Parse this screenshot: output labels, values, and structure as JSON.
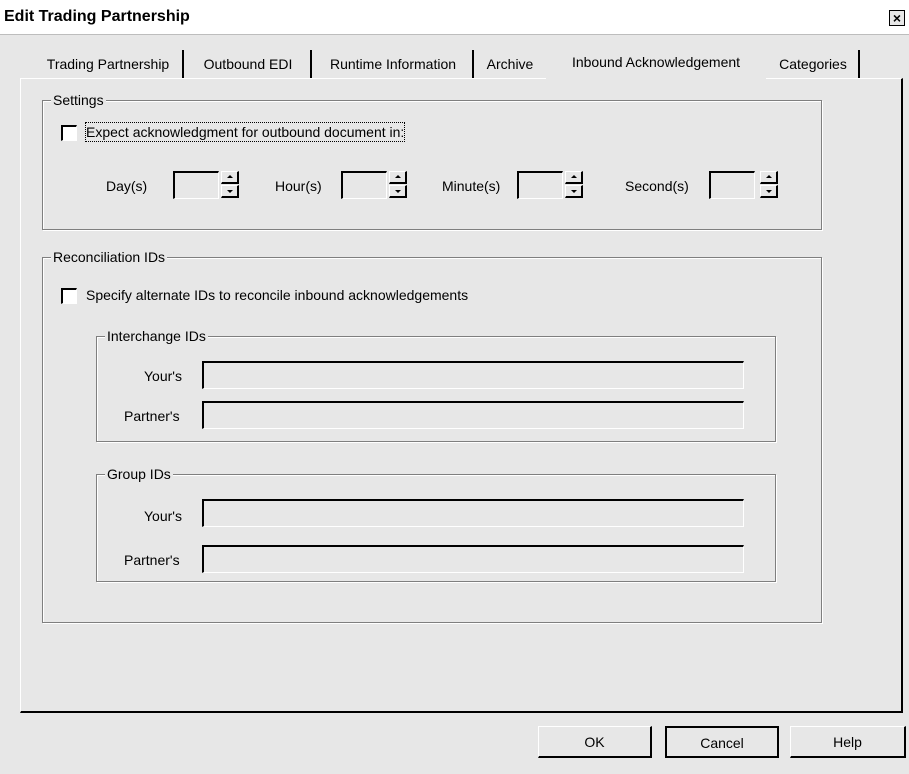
{
  "window": {
    "title": "Edit Trading Partnership",
    "close_glyph": "×"
  },
  "tabs": [
    {
      "label": "Trading Partnership"
    },
    {
      "label": "Outbound EDI"
    },
    {
      "label": "Runtime Information"
    },
    {
      "label": "Archive"
    },
    {
      "label": "Inbound Acknowledgement",
      "active": true
    },
    {
      "label": "Categories"
    }
  ],
  "settings": {
    "legend": "Settings",
    "expect_ack_label": "Expect acknowledgment for outbound document in:",
    "expect_ack_checked": false,
    "fields": [
      {
        "label": "Day(s)",
        "value": ""
      },
      {
        "label": "Hour(s)",
        "value": ""
      },
      {
        "label": "Minute(s)",
        "value": ""
      },
      {
        "label": "Second(s)",
        "value": ""
      }
    ]
  },
  "reconciliation": {
    "legend": "Reconciliation IDs",
    "alternate_label": "Specify alternate IDs to reconcile inbound acknowledgements",
    "alternate_checked": false,
    "interchange": {
      "legend": "Interchange IDs",
      "yours_label": "Your's",
      "yours_value": "",
      "partners_label": "Partner's",
      "partners_value": ""
    },
    "group": {
      "legend": "Group IDs",
      "yours_label": "Your's",
      "yours_value": "",
      "partners_label": "Partner's",
      "partners_value": ""
    }
  },
  "buttons": {
    "ok": "OK",
    "cancel": "Cancel",
    "help": "Help"
  }
}
